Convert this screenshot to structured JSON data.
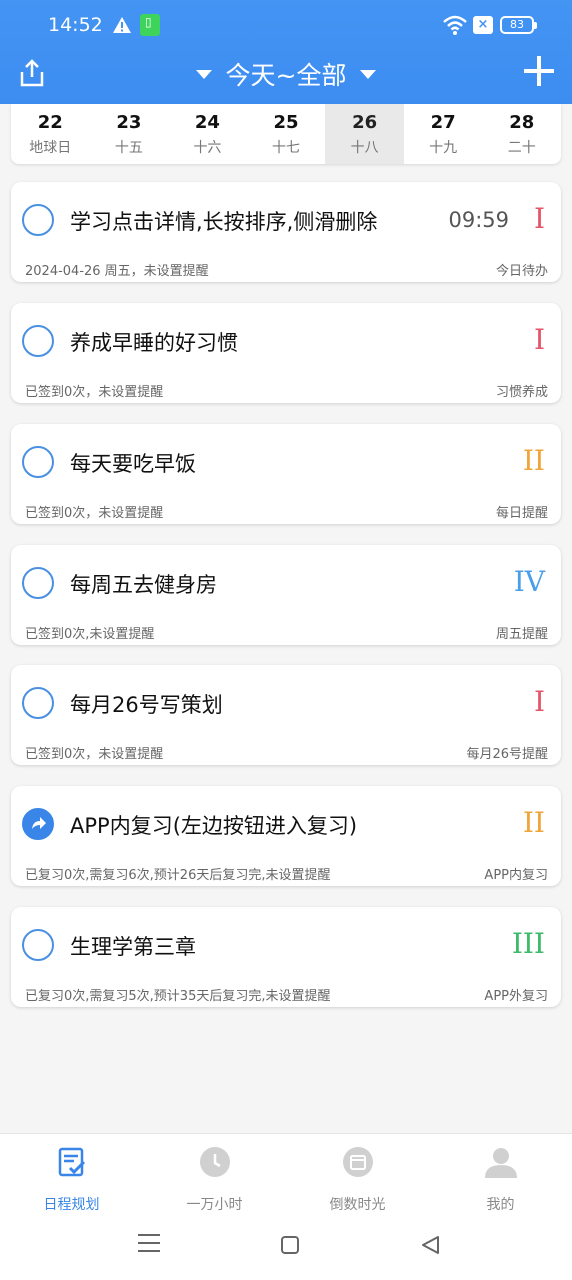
{
  "status_bar": {
    "time": "14:52",
    "battery": "83"
  },
  "navbar": {
    "title": "今天~全部"
  },
  "dates": [
    {
      "day": "22",
      "lunar": "地球日",
      "selected": false
    },
    {
      "day": "23",
      "lunar": "十五",
      "selected": false
    },
    {
      "day": "24",
      "lunar": "十六",
      "selected": false
    },
    {
      "day": "25",
      "lunar": "十七",
      "selected": false
    },
    {
      "day": "26",
      "lunar": "十八",
      "selected": true
    },
    {
      "day": "27",
      "lunar": "十九",
      "selected": false
    },
    {
      "day": "28",
      "lunar": "二十",
      "selected": false
    }
  ],
  "cards": [
    {
      "title": "学习点击详情,长按排序,侧滑删除",
      "time": "09:59",
      "priority": "I",
      "priority_color": "#e5566a",
      "sub": "2024-04-26 周五，未设置提醒",
      "tag": "今日待办",
      "icon": "circle"
    },
    {
      "title": "养成早睡的好习惯",
      "time": "",
      "priority": "I",
      "priority_color": "#e5566a",
      "sub": "已签到0次，未设置提醒",
      "tag": "习惯养成",
      "icon": "circle"
    },
    {
      "title": "每天要吃早饭",
      "time": "",
      "priority": "II",
      "priority_color": "#f0a53a",
      "sub": "已签到0次，未设置提醒",
      "tag": "每日提醒",
      "icon": "circle"
    },
    {
      "title": "每周五去健身房",
      "time": "",
      "priority": "IV",
      "priority_color": "#4b9fe8",
      "sub": "已签到0次,未设置提醒",
      "tag": "周五提醒",
      "icon": "circle"
    },
    {
      "title": "每月26号写策划",
      "time": "",
      "priority": "I",
      "priority_color": "#e5566a",
      "sub": "已签到0次，未设置提醒",
      "tag": "每月26号提醒",
      "icon": "circle"
    },
    {
      "title": "APP内复习(左边按钮进入复习)",
      "time": "",
      "priority": "II",
      "priority_color": "#f0a53a",
      "sub": "已复习0次,需复习6次,预计26天后复习完,未设置提醒",
      "tag": "APP内复习",
      "icon": "forward"
    },
    {
      "title": "生理学第三章",
      "time": "",
      "priority": "III",
      "priority_color": "#3dbb6a",
      "sub": "已复习0次,需复习5次,预计35天后复习完,未设置提醒",
      "tag": "APP外复习",
      "icon": "circle"
    }
  ],
  "tabs": [
    {
      "label": "日程规划",
      "active": true
    },
    {
      "label": "一万小时",
      "active": false
    },
    {
      "label": "倒数时光",
      "active": false
    },
    {
      "label": "我的",
      "active": false
    }
  ],
  "colors": {
    "accent": "#3a86e8",
    "header": "#4394f3"
  }
}
